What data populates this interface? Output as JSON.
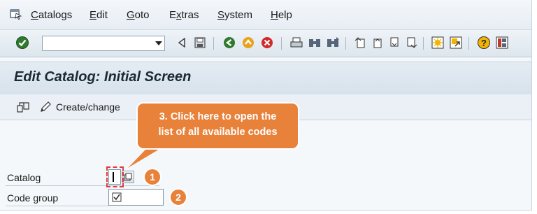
{
  "menu": {
    "items": [
      {
        "label": "Catalogs",
        "underline": "C"
      },
      {
        "label": "Edit",
        "underline": "E"
      },
      {
        "label": "Goto",
        "underline": "G"
      },
      {
        "label": "Extras",
        "underline": "x"
      },
      {
        "label": "System",
        "underline": "S"
      },
      {
        "label": "Help",
        "underline": "H"
      }
    ]
  },
  "toolbar": {
    "command_field_value": "",
    "icons": [
      "enter-icon",
      "back-triangle-icon",
      "save-icon",
      "back-icon",
      "exit-icon",
      "cancel-icon",
      "print-icon",
      "find-icon",
      "find-next-icon",
      "first-page-icon",
      "previous-page-icon",
      "next-page-icon",
      "last-page-icon",
      "create-session-icon",
      "shortcut-icon",
      "help-icon",
      "layout-menu-icon"
    ]
  },
  "screen": {
    "title": "Edit Catalog: Initial Screen"
  },
  "app_toolbar": {
    "create_change_label": "Create/change"
  },
  "form": {
    "catalog_label": "Catalog",
    "catalog_value": "",
    "code_group_label": "Code group",
    "code_group_value": ""
  },
  "annotations": {
    "callout_text_line1": "3. Click here to open the",
    "callout_text_line2": "list of all available codes",
    "badge_1": "1",
    "badge_2": "2"
  },
  "colors": {
    "accent_orange": "#e8823b",
    "highlight_red": "#e23b3b"
  }
}
